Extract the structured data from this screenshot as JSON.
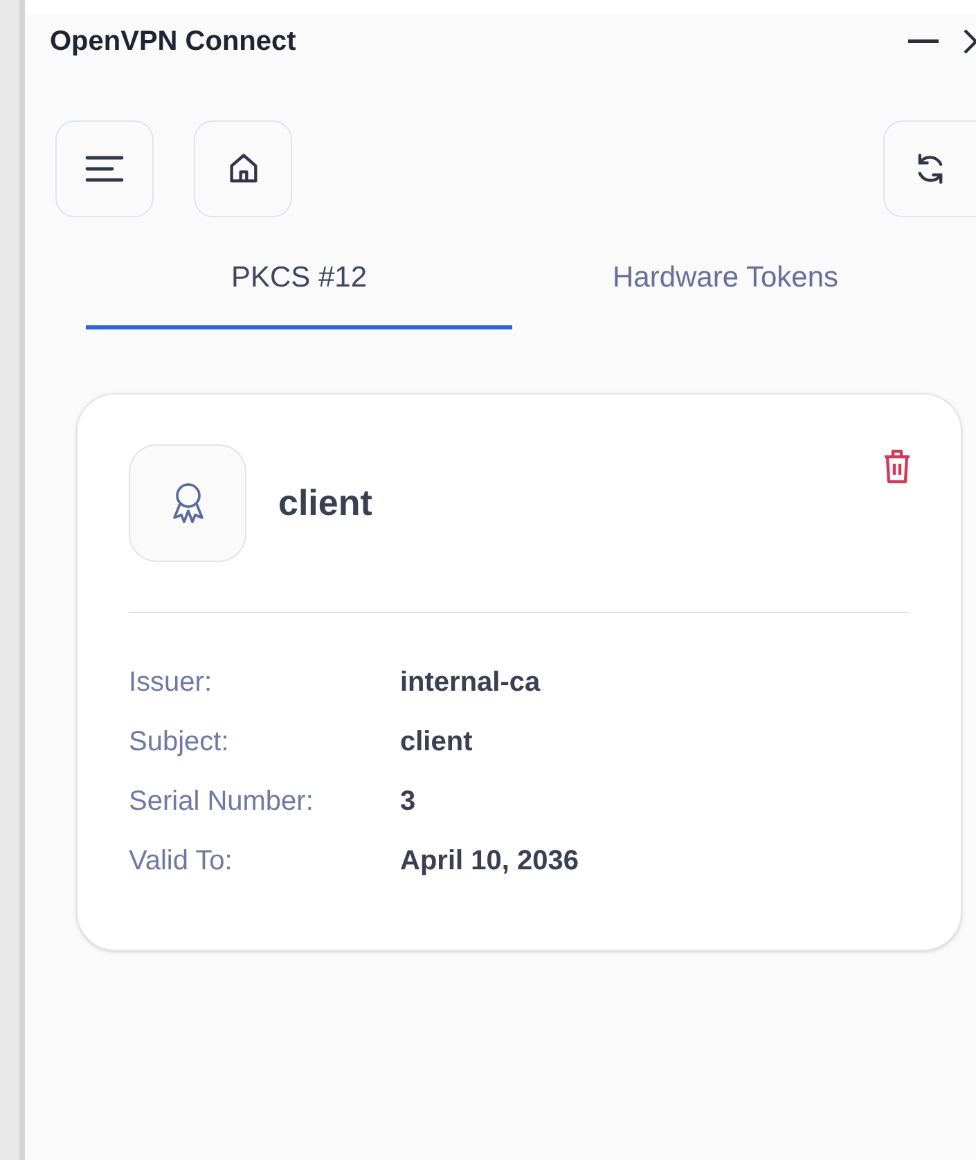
{
  "window": {
    "title": "OpenVPN Connect"
  },
  "tabs": [
    {
      "label": "PKCS #12",
      "selected": true
    },
    {
      "label": "Hardware Tokens",
      "selected": false
    }
  ],
  "certificate": {
    "name": "client",
    "fields": [
      {
        "label": "Issuer:",
        "value": "internal-ca"
      },
      {
        "label": "Subject:",
        "value": "client"
      },
      {
        "label": "Serial Number:",
        "value": "3"
      },
      {
        "label": "Valid To:",
        "value": "April 10, 2036"
      }
    ]
  }
}
